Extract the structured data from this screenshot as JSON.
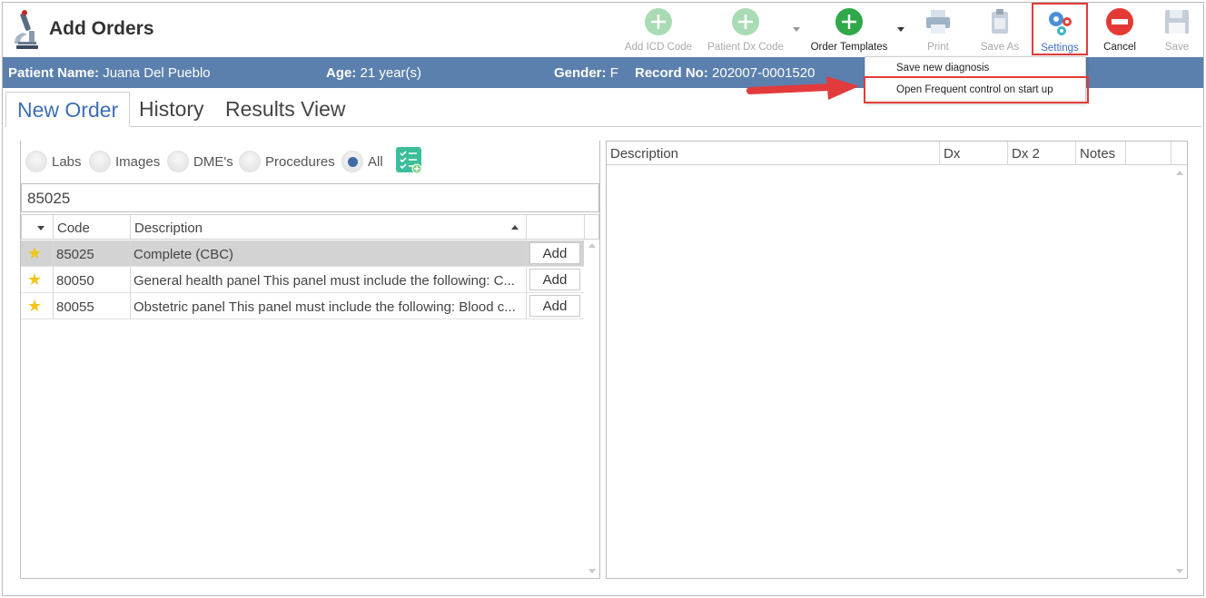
{
  "app": {
    "title": "Add Orders"
  },
  "toolbar": {
    "add_icd_code": "Add ICD Code",
    "patient_dx_code": "Patient Dx Code",
    "order_templates": "Order Templates",
    "print": "Print",
    "save_as": "Save As",
    "settings": "Settings",
    "cancel": "Cancel",
    "save": "Save"
  },
  "patient": {
    "name_label": "Patient Name:",
    "name": "Juana Del Pueblo",
    "age_label": "Age:",
    "age": "21 year(s)",
    "gender_label": "Gender:",
    "gender": "F",
    "record_label": "Record No:",
    "record": "202007-0001520"
  },
  "settings_menu": {
    "items": [
      "Save new diagnosis",
      "Open Frequent control on start up"
    ]
  },
  "tabs": [
    "New Order",
    "History",
    "Results View"
  ],
  "filters": {
    "options": [
      "Labs",
      "Images",
      "DME's",
      "Procedures",
      "All"
    ],
    "selected": "All"
  },
  "search": {
    "value": "85025"
  },
  "order_grid": {
    "columns": [
      "Code",
      "Description"
    ],
    "rows": [
      {
        "code": "85025",
        "description": "Complete (CBC)",
        "action": "Add"
      },
      {
        "code": "80050",
        "description": "General health panel This panel must include the following: C...",
        "action": "Add"
      },
      {
        "code": "80055",
        "description": "Obstetric panel This panel must include the following: Blood c...",
        "action": "Add"
      }
    ]
  },
  "selected_grid": {
    "columns": [
      "Description",
      "Dx",
      "Dx 2",
      "Notes"
    ]
  },
  "colors": {
    "patient_bar": "#5b80ad",
    "accent": "#3d6fb6",
    "highlight": "#e23b3b",
    "star": "#f2c417"
  }
}
